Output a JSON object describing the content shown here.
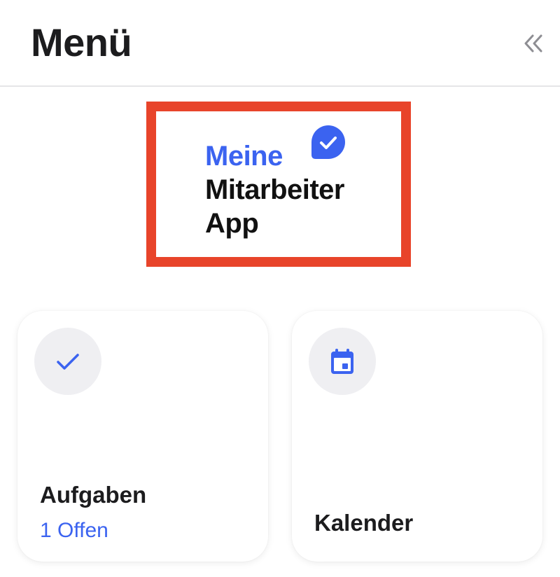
{
  "header": {
    "title": "Menü",
    "collapse_icon": "double-chevron-left-icon"
  },
  "logo": {
    "line1": "Meine",
    "line2": "Mitarbeiter",
    "line3": "App",
    "badge_icon": "check-bubble-icon",
    "colors": {
      "accent": "#3b63f0",
      "frame": "#e8442a"
    }
  },
  "cards": {
    "tasks": {
      "icon": "checkmark-icon",
      "title": "Aufgaben",
      "subtitle": "1 Offen"
    },
    "calendar": {
      "icon": "calendar-icon",
      "title": "Kalender"
    }
  }
}
